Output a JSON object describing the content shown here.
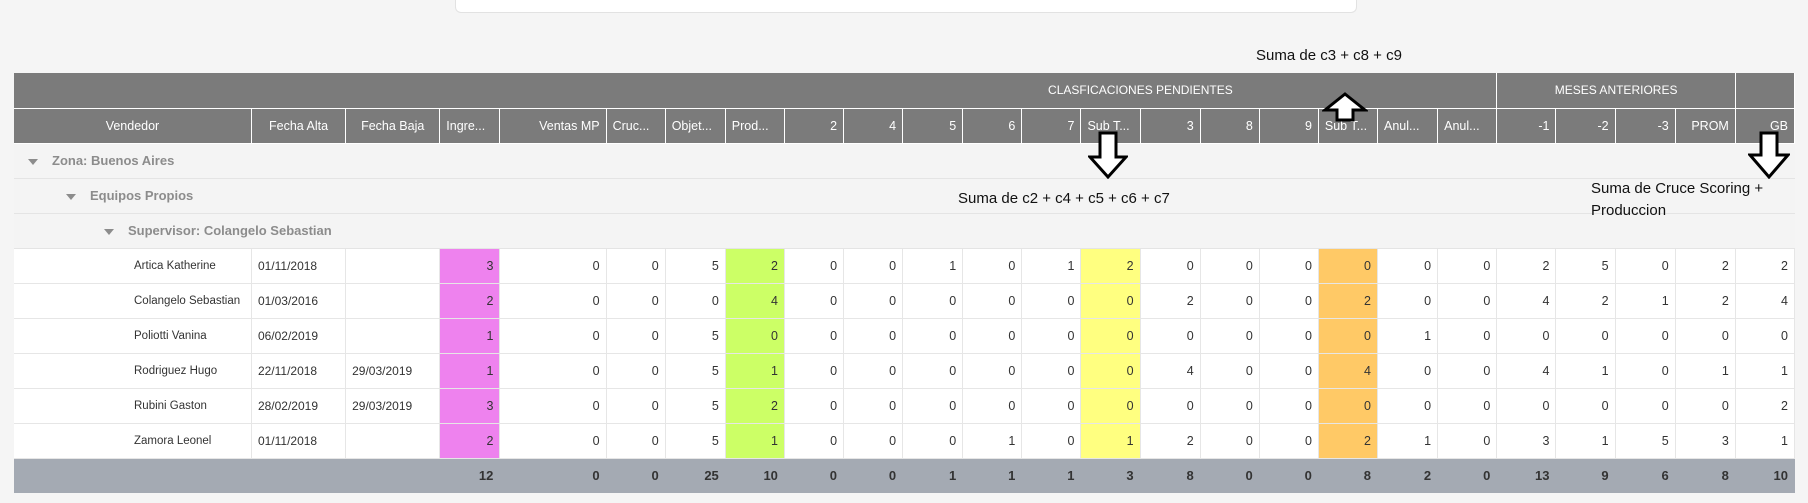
{
  "annotations": {
    "sum_c3_c8_c9": "Suma de c3 + c8 + c9",
    "sum_c2_c4_c5_c6_c7": "Suma de c2 + c4 + c5 + c6 + c7",
    "sum_cruce_produccion": "Suma de Cruce Scoring + Produccion"
  },
  "header_groups": {
    "clasificaciones": "CLASFICACIONES PENDIENTES",
    "meses_anteriores": "MESES ANTERIORES"
  },
  "columns": [
    "Vendedor",
    "Fecha Alta",
    "Fecha Baja",
    "Ingre...",
    "Ventas MP",
    "Cruc...",
    "Objet...",
    "Prod...",
    "2",
    "4",
    "5",
    "6",
    "7",
    "Sub T...",
    "3",
    "8",
    "9",
    "Sub T...",
    "Anul...",
    "Anul...",
    "-1",
    "-2",
    "-3",
    "PROM",
    "GB"
  ],
  "groups": {
    "zona": "Zona: Buenos Aires",
    "equipo": "Equipos Propios",
    "supervisor": "Supervisor: Colangelo Sebastian"
  },
  "rows": [
    {
      "name": "Artica Katherine",
      "alta": "01/11/2018",
      "baja": "",
      "v": [
        "3",
        "0",
        "0",
        "5",
        "2",
        "0",
        "0",
        "1",
        "0",
        "1",
        "2",
        "0",
        "0",
        "0",
        "0",
        "0",
        "0",
        "2",
        "5",
        "0",
        "2",
        "2"
      ]
    },
    {
      "name": "Colangelo Sebastian",
      "alta": "01/03/2016",
      "baja": "",
      "v": [
        "2",
        "0",
        "0",
        "0",
        "4",
        "0",
        "0",
        "0",
        "0",
        "0",
        "0",
        "2",
        "0",
        "0",
        "2",
        "0",
        "0",
        "4",
        "2",
        "1",
        "2",
        "4"
      ]
    },
    {
      "name": "Poliotti Vanina",
      "alta": "06/02/2019",
      "baja": "",
      "v": [
        "1",
        "0",
        "0",
        "5",
        "0",
        "0",
        "0",
        "0",
        "0",
        "0",
        "0",
        "0",
        "0",
        "0",
        "0",
        "1",
        "0",
        "0",
        "0",
        "0",
        "0",
        "0"
      ]
    },
    {
      "name": "Rodriguez Hugo",
      "alta": "22/11/2018",
      "baja": "29/03/2019",
      "v": [
        "1",
        "0",
        "0",
        "5",
        "1",
        "0",
        "0",
        "0",
        "0",
        "0",
        "0",
        "4",
        "0",
        "0",
        "4",
        "0",
        "0",
        "4",
        "1",
        "0",
        "1",
        "1"
      ]
    },
    {
      "name": "Rubini Gaston",
      "alta": "28/02/2019",
      "baja": "29/03/2019",
      "v": [
        "3",
        "0",
        "0",
        "5",
        "2",
        "0",
        "0",
        "0",
        "0",
        "0",
        "0",
        "0",
        "0",
        "0",
        "0",
        "0",
        "0",
        "0",
        "0",
        "0",
        "0",
        "2"
      ]
    },
    {
      "name": "Zamora Leonel",
      "alta": "01/11/2018",
      "baja": "",
      "v": [
        "2",
        "0",
        "0",
        "5",
        "1",
        "0",
        "0",
        "0",
        "1",
        "0",
        "1",
        "2",
        "0",
        "0",
        "2",
        "1",
        "0",
        "3",
        "1",
        "5",
        "3",
        "1"
      ]
    }
  ],
  "totals": [
    "12",
    "0",
    "0",
    "25",
    "10",
    "0",
    "0",
    "1",
    "1",
    "1",
    "3",
    "8",
    "0",
    "0",
    "8",
    "2",
    "0",
    "13",
    "9",
    "6",
    "8",
    "10"
  ],
  "colors": {
    "header_bg": "#7b7b7b",
    "ingresos": "#ee82ee",
    "produccion": "#ccff66",
    "subtotal_1": "#ffff80",
    "subtotal_2": "#ffc966",
    "footer_bg": "#a4aab3"
  },
  "icons": {
    "arrow_up": "arrow-up-outline-icon",
    "arrow_down": "arrow-down-outline-icon",
    "caret": "caret-down-icon"
  }
}
